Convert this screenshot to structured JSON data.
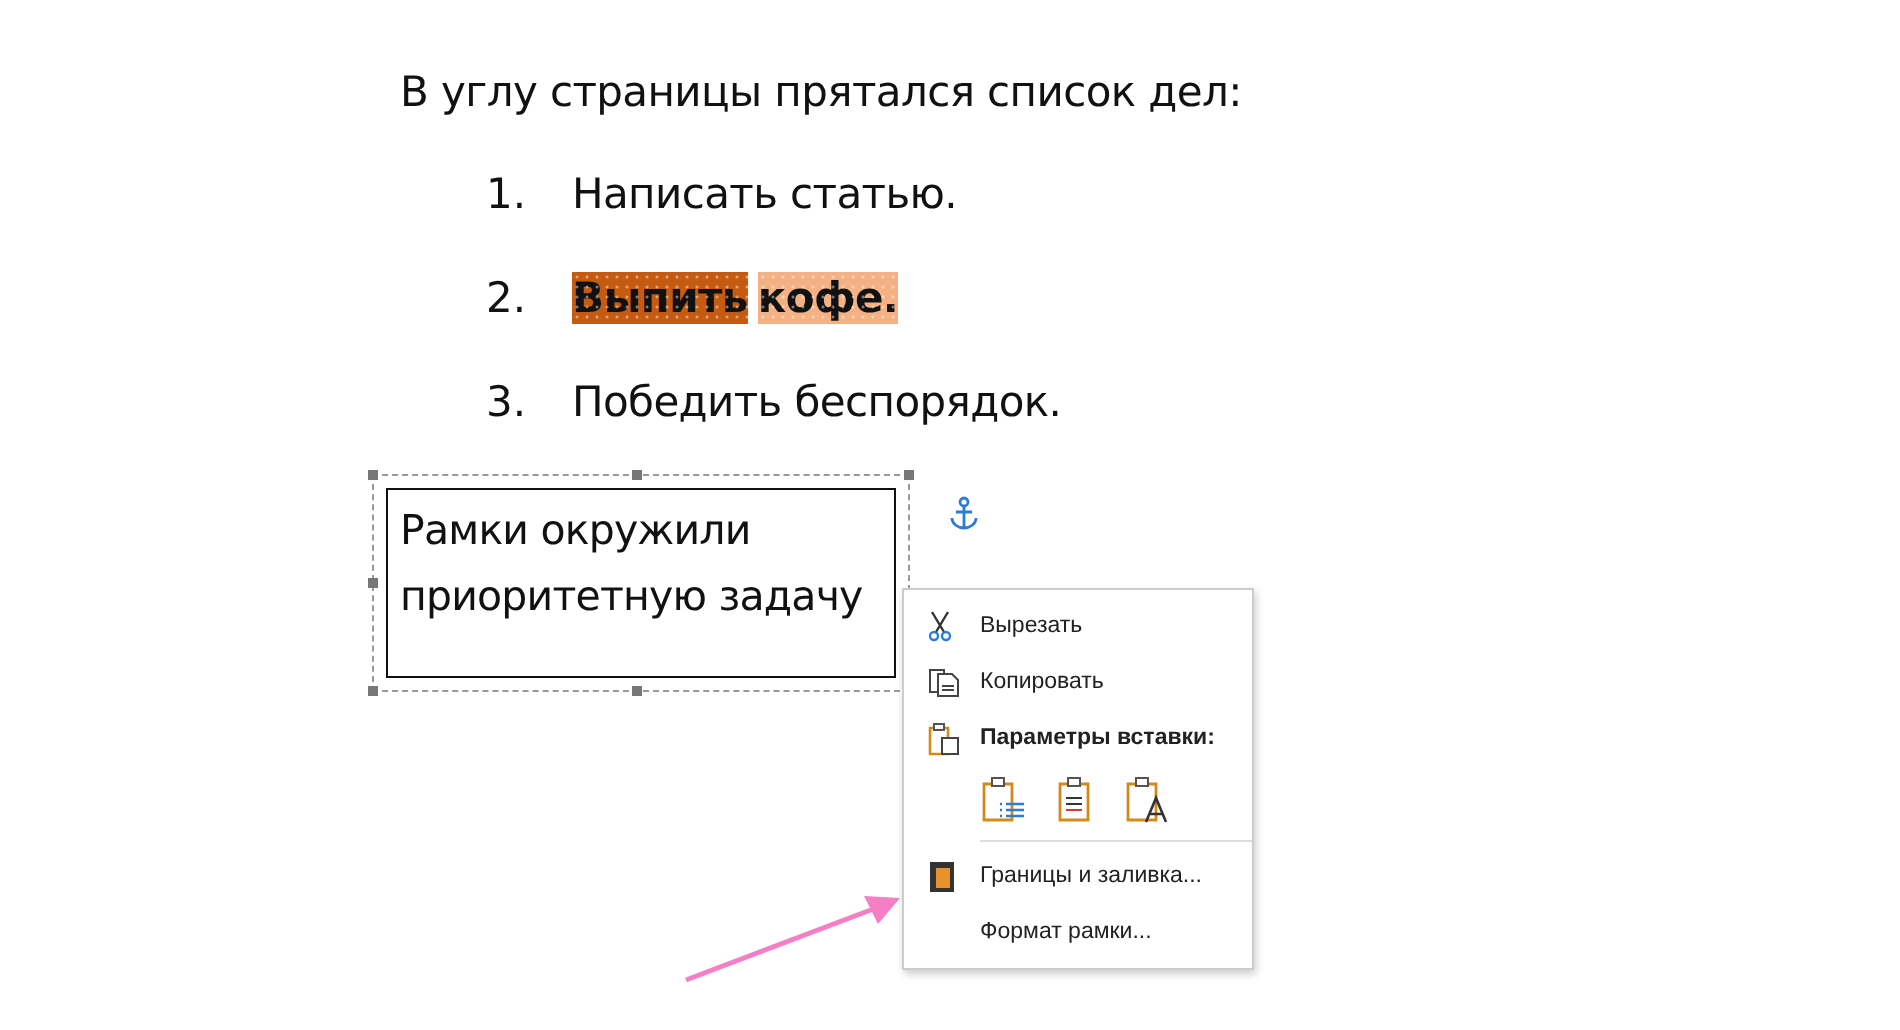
{
  "heading": "В углу страницы прятался список дел:",
  "list": [
    {
      "number": "1.",
      "segments": [
        {
          "text": "Написать статью."
        }
      ],
      "bold": false
    },
    {
      "number": "2.",
      "segments": [
        {
          "text": "Выпить",
          "color": "#c55a11"
        },
        {
          "text": "кофе.",
          "color": "#f4b183"
        }
      ],
      "bold": true
    },
    {
      "number": "3.",
      "segments": [
        {
          "text": "Победить беспорядок."
        }
      ],
      "bold": false
    }
  ],
  "frame": {
    "text": "Рамки окружили приоритетную задачу",
    "selected": true
  },
  "context_menu": {
    "items": [
      {
        "kind": "command",
        "label": "Вырезать"
      },
      {
        "kind": "command",
        "label": "Копировать"
      },
      {
        "kind": "header",
        "label": "Параметры вставки:"
      },
      {
        "kind": "paste-options",
        "options": [
          {
            "kind": "list"
          },
          {
            "kind": "lines"
          },
          {
            "kind": "text"
          }
        ]
      },
      {
        "kind": "separator"
      },
      {
        "kind": "command",
        "label": "Границы и заливка..."
      },
      {
        "kind": "command",
        "label": "Формат рамки..."
      }
    ]
  }
}
